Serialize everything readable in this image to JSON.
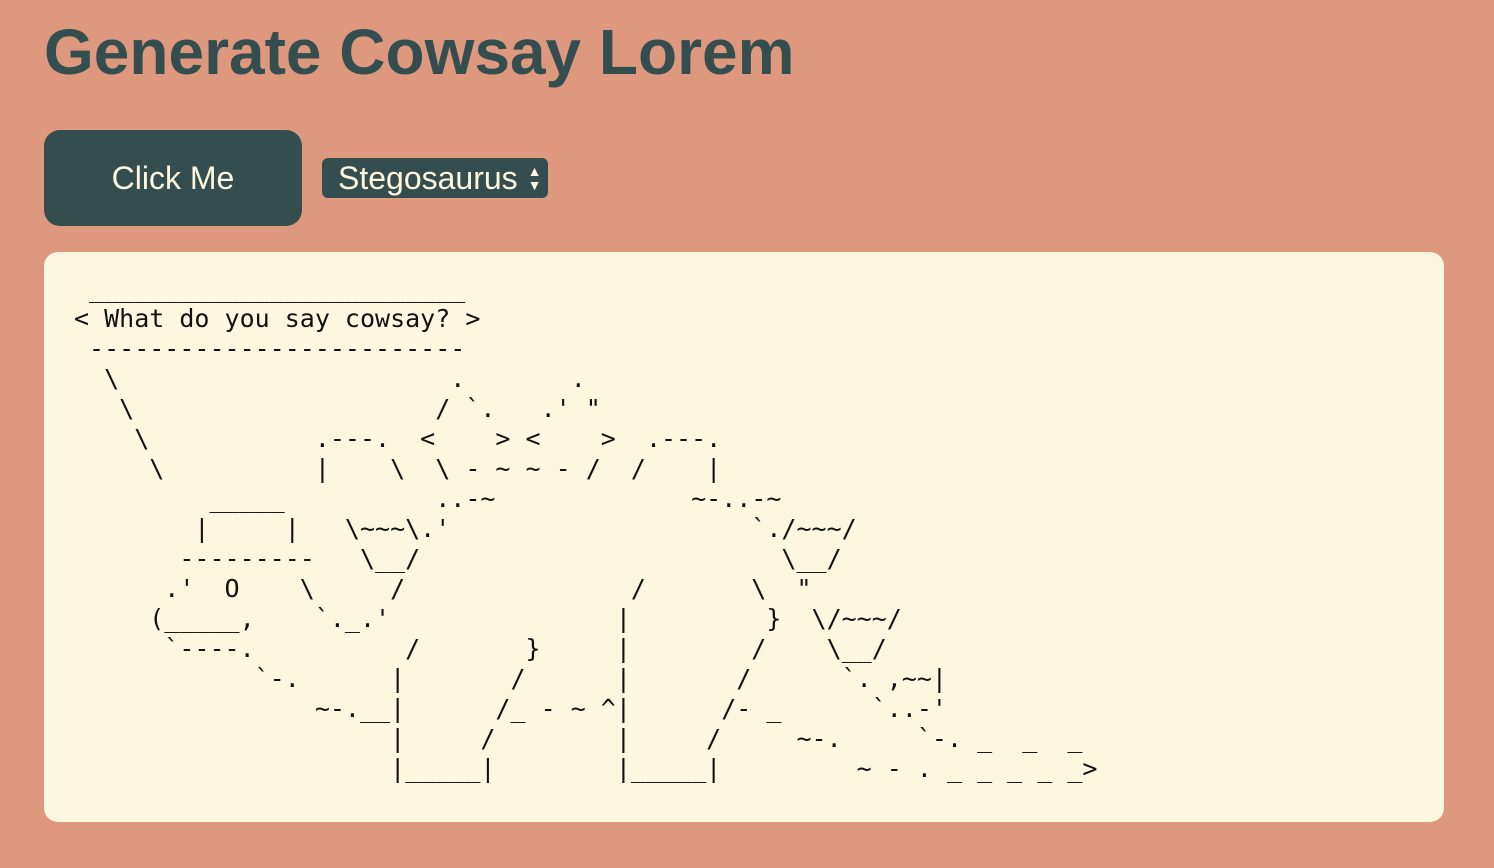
{
  "page": {
    "title": "Generate Cowsay Lorem"
  },
  "controls": {
    "button_label": "Click Me",
    "animal_select": {
      "selected": "Stegosaurus"
    }
  },
  "output": {
    "ascii": " _________________________\n< What do you say cowsay? >\n -------------------------\n  \\                      .       .\n   \\                    / `.   .' \"\n    \\           .---.  <    > <    >  .---.\n     \\          |    \\  \\ - ~ ~ - /  /    |\n         _____          ..-~             ~-..-~\n        |     |   \\~~~\\.'                    `./~~~/\n       ---------   \\__/                        \\__/\n      .'  O    \\     /               /       \\  \"\n     (_____,    `._.'               |         }  \\/~~~/\n      `----.          /       }     |        /    \\__/\n            `-.      |       /      |       /      `. ,~~|\n                ~-.__|      /_ - ~ ^|      /- _      `..-'\n                     |     /        |     /     ~-.     `-. _  _  _\n                     |_____|        |_____|         ~ - . _ _ _ _ _>"
  },
  "colors": {
    "background": "#de987e",
    "primary": "#344e4f",
    "panel": "#fdf7df",
    "button_text": "#fdf7e0"
  }
}
